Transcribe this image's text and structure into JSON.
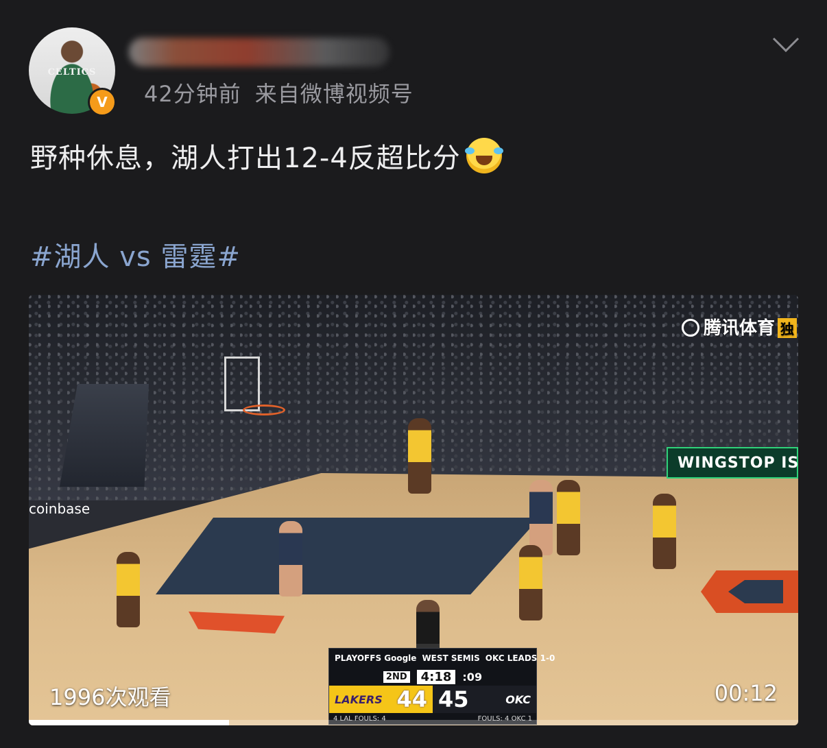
{
  "post": {
    "time_ago": "42分钟前",
    "source": "来自微博视频号",
    "text": "野种休息，湖人打出12-4反超比分",
    "emoji": "laugh-cry-emoji",
    "hashtag": "#湖人 vs 雷霆#"
  },
  "avatar": {
    "jersey": "CELTICS",
    "verified_mark": "V",
    "verified_color": "#f59b1a"
  },
  "video": {
    "views": "1996次观看",
    "duration": "00:12",
    "progress": 0.26,
    "watermark": "腾讯体育",
    "watermark_badge": "独",
    "arena_ads": {
      "wingstop": "WINGSTOP IS",
      "coinbase": "coinbase"
    },
    "scorebug": {
      "playoffs": "PLAYOFFS Google",
      "series": "WEST SEMIS",
      "series_status": "OKC LEADS 1-0",
      "quarter": "2ND",
      "clock": "4:18",
      "shot_clock": ":09",
      "home_abbr": "LAKERS",
      "home_score": "44",
      "away_abbr": "OKC",
      "away_score": "45",
      "home_fouls": "4 LAL    FOULS: 4",
      "away_fouls": "FOULS: 4    OKC 1"
    }
  },
  "colors": {
    "background": "#1b1b1d",
    "hashtag": "#8aa5cf",
    "meta": "#9a9aa0"
  }
}
